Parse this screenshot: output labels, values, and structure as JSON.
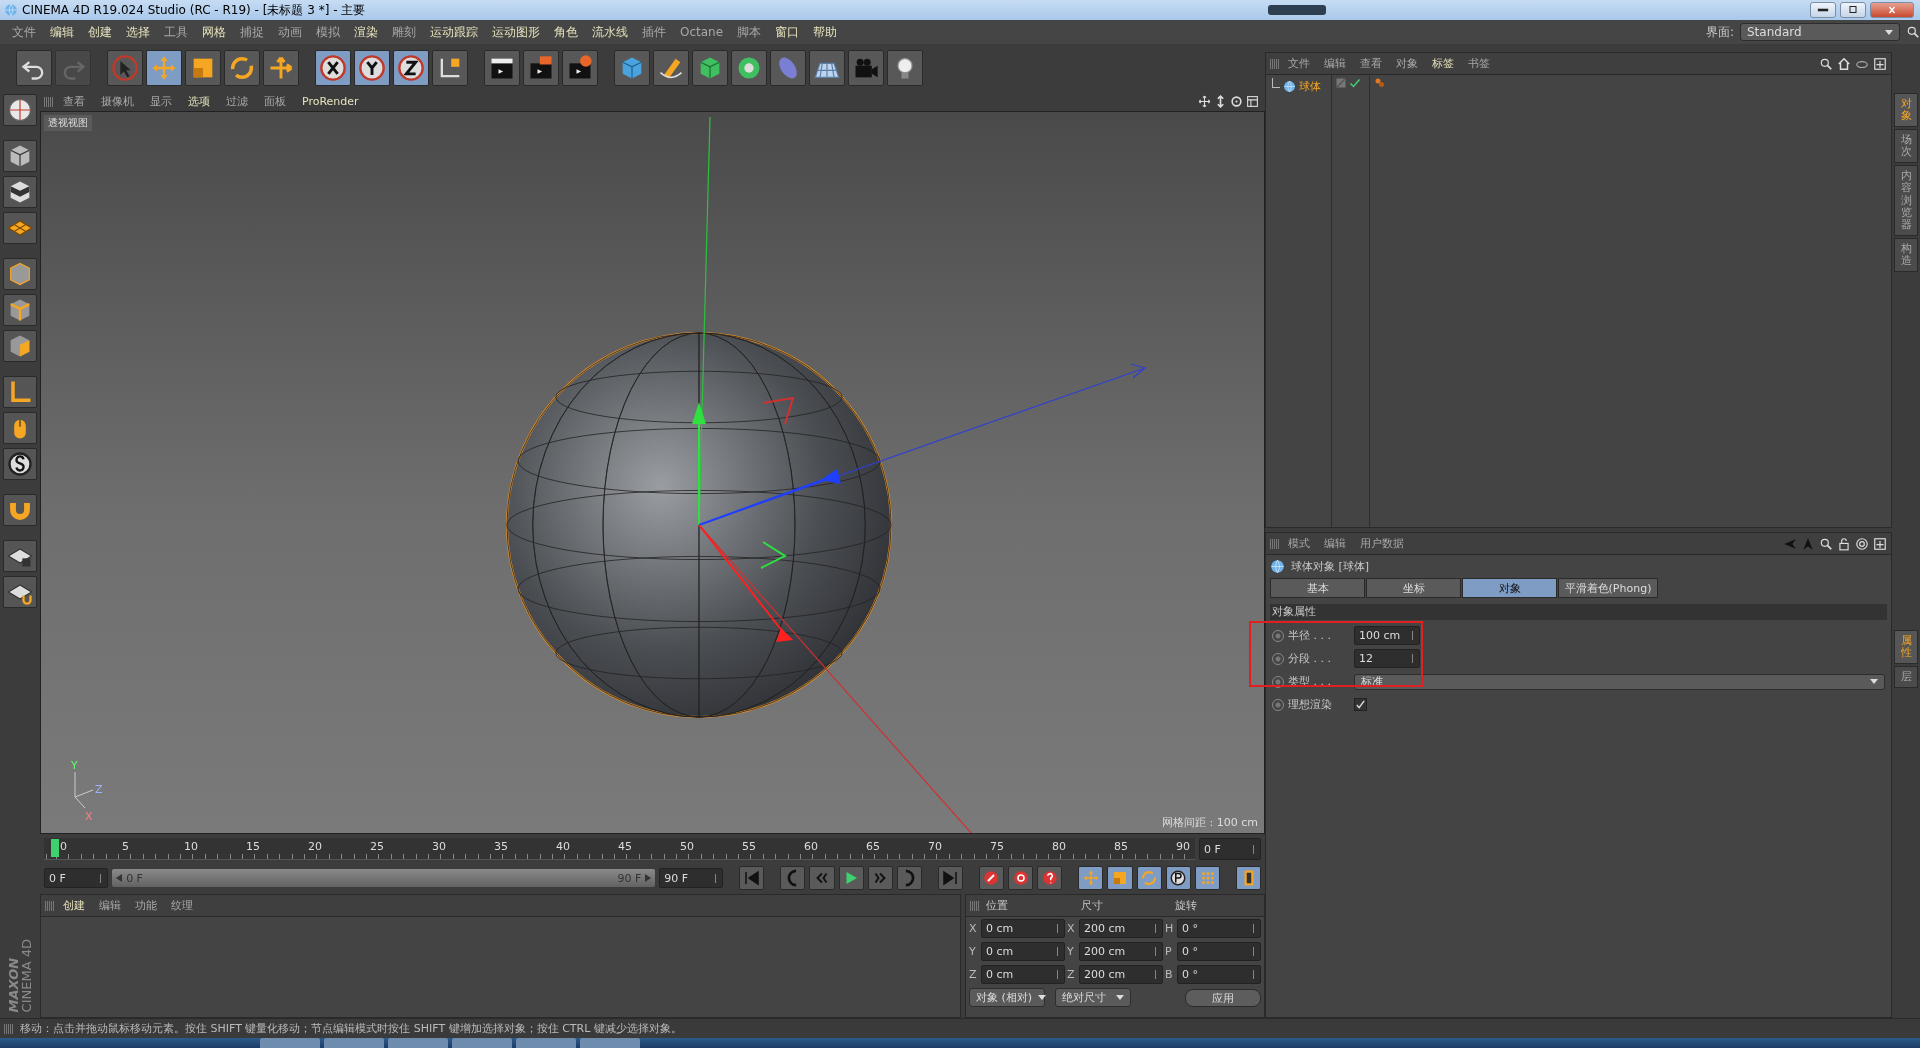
{
  "window": {
    "title": "CINEMA 4D R19.024 Studio (RC - R19) - [未标题 3 *] - 主要"
  },
  "menu": [
    {
      "label": "文件",
      "highlighted": false
    },
    {
      "label": "编辑",
      "highlighted": true
    },
    {
      "label": "创建",
      "highlighted": true
    },
    {
      "label": "选择",
      "highlighted": true
    },
    {
      "label": "工具",
      "highlighted": false
    },
    {
      "label": "网格",
      "highlighted": true
    },
    {
      "label": "捕捉",
      "highlighted": false
    },
    {
      "label": "动画",
      "highlighted": false
    },
    {
      "label": "模拟",
      "highlighted": false
    },
    {
      "label": "渲染",
      "highlighted": true
    },
    {
      "label": "雕刻",
      "highlighted": false
    },
    {
      "label": "运动跟踪",
      "highlighted": true
    },
    {
      "label": "运动图形",
      "highlighted": true
    },
    {
      "label": "角色",
      "highlighted": true
    },
    {
      "label": "流水线",
      "highlighted": true
    },
    {
      "label": "插件",
      "highlighted": false
    },
    {
      "label": "Octane",
      "highlighted": false
    },
    {
      "label": "脚本",
      "highlighted": false
    },
    {
      "label": "窗口",
      "highlighted": true
    },
    {
      "label": "帮助",
      "highlighted": true
    }
  ],
  "layout_switch": {
    "label": "界面:",
    "value": "Standard"
  },
  "toolbar": [
    {
      "kind": "undo",
      "selected": false,
      "disabled": false
    },
    {
      "kind": "redo",
      "selected": false,
      "disabled": true
    },
    {
      "kind": "select",
      "selected": false,
      "disabled": false
    },
    {
      "kind": "move",
      "selected": true,
      "disabled": false
    },
    {
      "kind": "scale",
      "selected": false,
      "disabled": false
    },
    {
      "kind": "rotate",
      "selected": false,
      "disabled": false
    },
    {
      "kind": "transform",
      "selected": false,
      "disabled": false
    },
    {
      "kind": "x",
      "selected": true,
      "disabled": false
    },
    {
      "kind": "y",
      "selected": true,
      "disabled": false
    },
    {
      "kind": "z",
      "selected": true,
      "disabled": false
    },
    {
      "kind": "coords",
      "selected": false,
      "disabled": false
    },
    {
      "kind": "render-view",
      "selected": false,
      "disabled": false
    },
    {
      "kind": "render-picture",
      "selected": false,
      "disabled": false
    },
    {
      "kind": "render-settings",
      "selected": false,
      "disabled": false
    },
    {
      "kind": "cube",
      "selected": false,
      "disabled": false
    },
    {
      "kind": "pen",
      "selected": false,
      "disabled": false
    },
    {
      "kind": "subdivide",
      "selected": false,
      "disabled": false
    },
    {
      "kind": "array",
      "selected": false,
      "disabled": false
    },
    {
      "kind": "deformer",
      "selected": false,
      "disabled": false
    },
    {
      "kind": "floor",
      "selected": false,
      "disabled": false
    },
    {
      "kind": "camera",
      "selected": false,
      "disabled": false
    },
    {
      "kind": "light",
      "selected": false,
      "disabled": false
    }
  ],
  "viewport": {
    "menu": [
      {
        "label": "查看",
        "highlighted": false
      },
      {
        "label": "摄像机",
        "highlighted": false
      },
      {
        "label": "显示",
        "highlighted": false
      },
      {
        "label": "选项",
        "highlighted": true
      },
      {
        "label": "过滤",
        "highlighted": false
      },
      {
        "label": "面板",
        "highlighted": false
      },
      {
        "label": "ProRender",
        "highlighted": true
      }
    ],
    "view_name": "透视视图",
    "grid_spacing": "网格间距 : 100 cm",
    "axis_labels": [
      "Y",
      "Z",
      "X"
    ]
  },
  "timeline": {
    "ticks": [
      "0",
      "5",
      "10",
      "15",
      "20",
      "25",
      "30",
      "35",
      "40",
      "45",
      "50",
      "55",
      "60",
      "65",
      "70",
      "75",
      "80",
      "85",
      "90"
    ],
    "level": 0,
    "current_frame": "0 F",
    "start_field": "0 F",
    "range": {
      "start": "0 F",
      "end": "90 F",
      "level": 1
    },
    "end_field": "90 F",
    "key_tools": [
      {
        "kind": "record",
        "selected": false
      },
      {
        "kind": "autokey",
        "selected": false
      },
      {
        "kind": "keyset",
        "selected": false
      },
      {
        "kind": "key-move",
        "selected": true
      },
      {
        "kind": "key-scale",
        "selected": true
      },
      {
        "kind": "key-rotate",
        "selected": true
      },
      {
        "kind": "key-param",
        "selected": true
      },
      {
        "kind": "key-points",
        "selected": true
      },
      {
        "kind": "timeline-window",
        "selected": true
      }
    ]
  },
  "material_manager": {
    "menu": [
      {
        "label": "创建",
        "highlighted": true
      },
      {
        "label": "编辑",
        "highlighted": false
      },
      {
        "label": "功能",
        "highlighted": false
      },
      {
        "label": "纹理",
        "highlighted": false
      }
    ]
  },
  "logo": {
    "brand": "MAXON",
    "product": "CINEMA 4D"
  },
  "coordinates": {
    "headers": [
      "位置",
      "尺寸",
      "旋转"
    ],
    "rows": [
      {
        "pos_axis": "X",
        "pos": "0 cm",
        "size_axis": "X",
        "size": "200 cm",
        "rot_axis": "H",
        "rot": "0 °"
      },
      {
        "pos_axis": "Y",
        "pos": "0 cm",
        "size_axis": "Y",
        "size": "200 cm",
        "rot_axis": "P",
        "rot": "0 °"
      },
      {
        "pos_axis": "Z",
        "pos": "0 cm",
        "size_axis": "Z",
        "size": "200 cm",
        "rot_axis": "B",
        "rot": "0 °"
      }
    ],
    "mode": "对象 (相对)",
    "size_mode": "绝对尺寸",
    "apply": "应用"
  },
  "object_manager": {
    "menu": [
      {
        "label": "文件",
        "highlighted": false
      },
      {
        "label": "编辑",
        "highlighted": false
      },
      {
        "label": "查看",
        "highlighted": false
      },
      {
        "label": "对象",
        "highlighted": false
      },
      {
        "label": "标签",
        "highlighted": true
      },
      {
        "label": "书签",
        "highlighted": false
      }
    ],
    "objects": [
      {
        "name": "球体",
        "selected": true,
        "enabled": true
      }
    ]
  },
  "attributes": {
    "menu": [
      {
        "label": "模式",
        "highlighted": false
      },
      {
        "label": "编辑",
        "highlighted": false
      },
      {
        "label": "用户数据",
        "highlighted": false
      }
    ],
    "title": "球体对象 [球体]",
    "tabs": [
      {
        "label": "基本",
        "selected": false
      },
      {
        "label": "坐标",
        "selected": false
      },
      {
        "label": "对象",
        "selected": true
      },
      {
        "label": "平滑着色(Phong)",
        "selected": false
      }
    ],
    "section": "对象属性",
    "params": [
      {
        "kind": "number",
        "label": "半径 . . .",
        "value": "100 cm",
        "animated": false
      },
      {
        "kind": "number",
        "label": "分段 . . .",
        "value": "12",
        "animated": false
      },
      {
        "kind": "dropdown",
        "label": "类型 . . .",
        "value": "标准",
        "animated": false
      },
      {
        "kind": "checkbox",
        "label": "理想渲染",
        "checked": true,
        "animated": false
      }
    ]
  },
  "side_tabs_top": [
    {
      "label": "对象",
      "selected": true
    },
    {
      "label": "场次",
      "selected": false
    },
    {
      "label": "内容浏览器",
      "selected": false
    },
    {
      "label": "构造",
      "selected": false
    }
  ],
  "side_tabs_bottom": [
    {
      "label": "属性",
      "selected": true
    },
    {
      "label": "层",
      "selected": false
    }
  ],
  "status_bar": "移动：点击并拖动鼠标移动元素。按住 SHIFT 键量化移动；节点编辑模式时按住 SHIFT 键增加选择对象；按住 CTRL 键减少选择对象。"
}
